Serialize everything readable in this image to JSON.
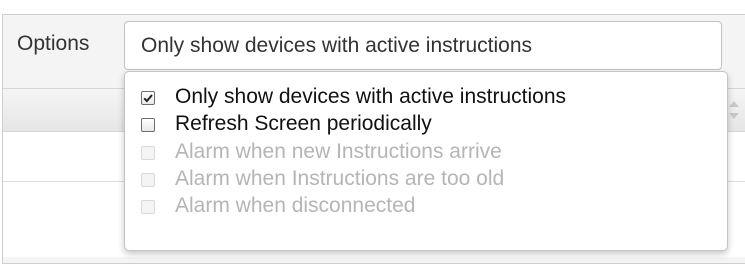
{
  "options": {
    "label": "Options",
    "selected_value": "Only show devices with active instructions",
    "dropdown_items": [
      {
        "label": "Only show devices with active instructions",
        "checked": true,
        "enabled": true
      },
      {
        "label": "Refresh Screen periodically",
        "checked": false,
        "enabled": true
      },
      {
        "label": "Alarm when new Instructions arrive",
        "checked": false,
        "enabled": false
      },
      {
        "label": "Alarm when Instructions are too old",
        "checked": false,
        "enabled": false
      },
      {
        "label": "Alarm when disconnected",
        "checked": false,
        "enabled": false
      }
    ]
  },
  "icons": {
    "checkmark": "checkmark-icon",
    "sort": "sort-icon"
  }
}
